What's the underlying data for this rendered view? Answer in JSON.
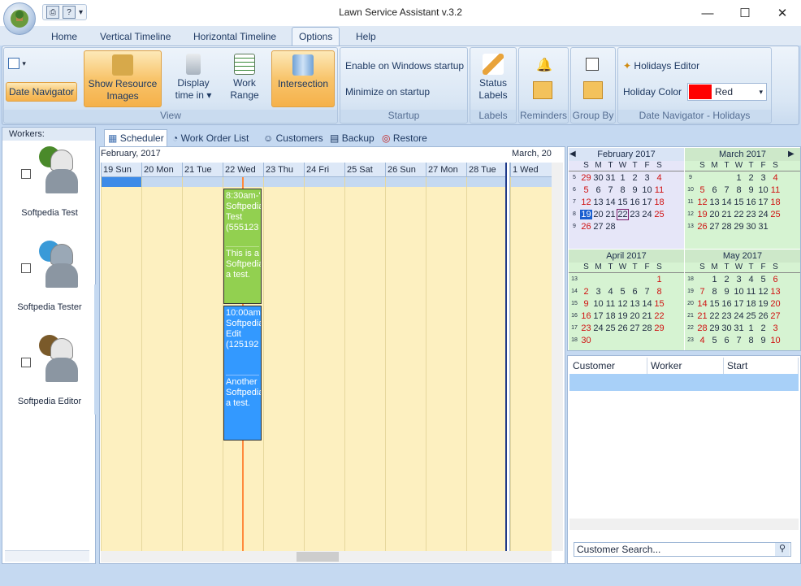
{
  "app": {
    "title": "Lawn Service Assistant v.3.2",
    "minimize": "—",
    "maximize": "☐",
    "close": "✕"
  },
  "tabs": [
    "Home",
    "Vertical Timeline",
    "Horizontal Timeline",
    "Options",
    "Help"
  ],
  "ribbon": {
    "view": {
      "label": "View",
      "date_navigator": "Date Navigator",
      "show_resource": "Show Resource\nImages",
      "display_time": "Display\ntime in ▾",
      "work_range": "Work\nRange",
      "intersection": "Intersection"
    },
    "startup": {
      "label": "Startup",
      "enable": "Enable on Windows startup",
      "minimize": "Minimize on startup"
    },
    "labels": {
      "label": "Labels",
      "status": "Status\nLabels"
    },
    "reminders": {
      "label": "Reminders"
    },
    "groupby": {
      "label": "Group By"
    },
    "holidays": {
      "label": "Date Navigator - Holidays",
      "editor": "Holidays Editor",
      "color_label": "Holiday Color",
      "color_value": "Red",
      "color": "#ff0000"
    }
  },
  "workers": {
    "header": "Workers:",
    "list": [
      {
        "name": "Softpedia Test"
      },
      {
        "name": "Softpedia Tester"
      },
      {
        "name": "Softpedia Editor"
      }
    ]
  },
  "main_tabs": [
    "Scheduler",
    "Work Order List",
    "Customers",
    "Backup",
    "Restore"
  ],
  "scheduler": {
    "month1": "February, 2017",
    "month2": "March, 20",
    "days": [
      "19 Sun",
      "20 Mon",
      "21 Tue",
      "22 Wed",
      "23 Thu",
      "24 Fri",
      "25 Sat",
      "26 Sun",
      "27 Mon",
      "28 Tue",
      "1 Wed"
    ],
    "appointments": [
      {
        "text1": "8:30am-'\nSoftpedia\nTest\n(555123",
        "text2": "This is a\nSoftpedia\na test.",
        "color": "#92d050"
      },
      {
        "text1": "10:00am\nSoftpedia\nEdit\n(125192",
        "text2": "Another\nSoftpedia\na test.",
        "color": "#3399ff"
      }
    ]
  },
  "calendars": {
    "dow": [
      "S",
      "M",
      "T",
      "W",
      "T",
      "F",
      "S"
    ],
    "months": [
      {
        "title": "February 2017",
        "weeks": [
          {
            "n": "5",
            "days": [
              "29",
              "30",
              "31",
              "1",
              "2",
              "3",
              "4"
            ]
          },
          {
            "n": "6",
            "days": [
              "5",
              "6",
              "7",
              "8",
              "9",
              "10",
              "11"
            ]
          },
          {
            "n": "7",
            "days": [
              "12",
              "13",
              "14",
              "15",
              "16",
              "17",
              "18"
            ]
          },
          {
            "n": "8",
            "days": [
              "19",
              "20",
              "21",
              "22",
              "23",
              "24",
              "25"
            ]
          },
          {
            "n": "9",
            "days": [
              "26",
              "27",
              "28",
              "",
              "",
              "",
              ""
            ]
          }
        ]
      },
      {
        "title": "March 2017",
        "weeks": [
          {
            "n": "9",
            "days": [
              "",
              "",
              "",
              "1",
              "2",
              "3",
              "4"
            ]
          },
          {
            "n": "10",
            "days": [
              "5",
              "6",
              "7",
              "8",
              "9",
              "10",
              "11"
            ]
          },
          {
            "n": "11",
            "days": [
              "12",
              "13",
              "14",
              "15",
              "16",
              "17",
              "18"
            ]
          },
          {
            "n": "12",
            "days": [
              "19",
              "20",
              "21",
              "22",
              "23",
              "24",
              "25"
            ]
          },
          {
            "n": "13",
            "days": [
              "26",
              "27",
              "28",
              "29",
              "30",
              "31",
              ""
            ]
          }
        ]
      },
      {
        "title": "April 2017",
        "weeks": [
          {
            "n": "13",
            "days": [
              "",
              "",
              "",
              "",
              "",
              "",
              "1"
            ]
          },
          {
            "n": "14",
            "days": [
              "2",
              "3",
              "4",
              "5",
              "6",
              "7",
              "8"
            ]
          },
          {
            "n": "15",
            "days": [
              "9",
              "10",
              "11",
              "12",
              "13",
              "14",
              "15"
            ]
          },
          {
            "n": "16",
            "days": [
              "16",
              "17",
              "18",
              "19",
              "20",
              "21",
              "22"
            ]
          },
          {
            "n": "17",
            "days": [
              "23",
              "24",
              "25",
              "26",
              "27",
              "28",
              "29"
            ]
          },
          {
            "n": "18",
            "days": [
              "30",
              "",
              "",
              "",
              "",
              "",
              ""
            ]
          }
        ]
      },
      {
        "title": "May 2017",
        "weeks": [
          {
            "n": "18",
            "days": [
              "",
              "1",
              "2",
              "3",
              "4",
              "5",
              "6"
            ]
          },
          {
            "n": "19",
            "days": [
              "7",
              "8",
              "9",
              "10",
              "11",
              "12",
              "13"
            ]
          },
          {
            "n": "20",
            "days": [
              "14",
              "15",
              "16",
              "17",
              "18",
              "19",
              "20"
            ]
          },
          {
            "n": "21",
            "days": [
              "21",
              "22",
              "23",
              "24",
              "25",
              "26",
              "27"
            ]
          },
          {
            "n": "22",
            "days": [
              "28",
              "29",
              "30",
              "31",
              "1",
              "2",
              "3"
            ]
          },
          {
            "n": "23",
            "days": [
              "4",
              "5",
              "6",
              "7",
              "8",
              "9",
              "10"
            ]
          }
        ]
      }
    ],
    "selected": "19",
    "today": "22"
  },
  "grid": {
    "columns": [
      "Customer",
      "Worker",
      "Start"
    ],
    "search_placeholder": "Customer Search..."
  }
}
